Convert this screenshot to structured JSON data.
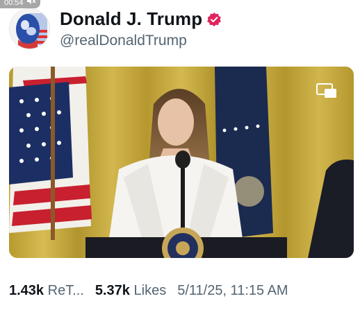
{
  "status": {
    "time": "00:54",
    "mute_icon": "speaker-muted-icon"
  },
  "post": {
    "display_name": "Donald J. Trump",
    "handle": "@realDonaldTrump",
    "verified": true,
    "badge_color": "#e0245e"
  },
  "media": {
    "type": "video",
    "pip_icon": "picture-in-picture-icon"
  },
  "stats": {
    "retweets_count": "1.43k",
    "retweets_label": "ReT...",
    "likes_count": "5.37k",
    "likes_label": "Likes",
    "date": "5/11/25, 11:15 AM"
  },
  "colors": {
    "text": "#0f1419",
    "secondary": "#536471"
  }
}
